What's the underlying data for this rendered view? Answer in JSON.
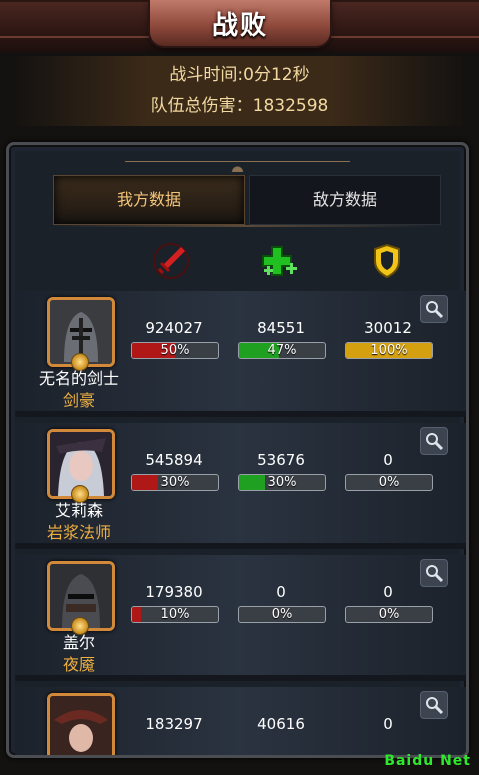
{
  "header": {
    "title": "战败",
    "battle_time": "战斗时间:0分12秒",
    "total_damage": "队伍总伤害：1832598"
  },
  "tabs": [
    {
      "label": "我方数据",
      "active": true
    },
    {
      "label": "敌方数据",
      "active": false
    }
  ],
  "columns": [
    {
      "icon": "sword-icon",
      "meaning": "damage",
      "color": "#d02020"
    },
    {
      "icon": "heal-cross-icon",
      "meaning": "healing",
      "color": "#22c022"
    },
    {
      "icon": "shield-icon",
      "meaning": "damage-taken",
      "color": "#f0c020"
    }
  ],
  "heroes": [
    {
      "name": "无名的剑士",
      "class": "剑豪",
      "damage": "924027",
      "damage_pct": "50%",
      "damage_fill": 0.5,
      "heal": "84551",
      "heal_pct": "47%",
      "heal_fill": 0.47,
      "tank": "30012",
      "tank_pct": "100%",
      "tank_fill": 1.0,
      "portrait": "knight-helmet"
    },
    {
      "name": "艾莉森",
      "class": "岩浆法师",
      "damage": "545894",
      "damage_pct": "30%",
      "damage_fill": 0.3,
      "heal": "53676",
      "heal_pct": "30%",
      "heal_fill": 0.3,
      "tank": "0",
      "tank_pct": "0%",
      "tank_fill": 0.0,
      "portrait": "white-hair-mage"
    },
    {
      "name": "盖尔",
      "class": "夜魇",
      "damage": "179380",
      "damage_pct": "10%",
      "damage_fill": 0.1,
      "heal": "0",
      "heal_pct": "0%",
      "heal_fill": 0.0,
      "tank": "0",
      "tank_pct": "0%",
      "tank_fill": 0.0,
      "portrait": "dark-knight"
    },
    {
      "name": "",
      "class": "",
      "damage": "183297",
      "damage_pct": "",
      "damage_fill": 0.0,
      "heal": "40616",
      "heal_pct": "",
      "heal_fill": 0.0,
      "tank": "0",
      "tank_pct": "",
      "tank_fill": 0.0,
      "portrait": "red-hood"
    }
  ],
  "watermark": "Baidu Net",
  "colors": {
    "damage": "#b01818",
    "heal": "#1fa020",
    "tank": "#d4a010",
    "accent": "#f0b040"
  }
}
